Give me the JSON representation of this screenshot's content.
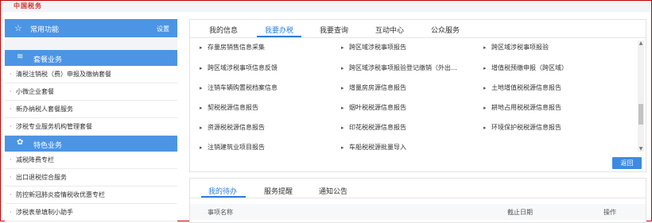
{
  "header": {
    "logo_text": "中国税务"
  },
  "sidebar": {
    "common": {
      "title": "常用功能",
      "setting": "设置"
    },
    "categories": [
      {
        "title": "套餐业务",
        "items": [
          "清税注销税（费）申报及缴纳套餐",
          "小微企业套餐",
          "新办纳税人套餐服务",
          "涉税专业服务机构管理套餐"
        ]
      },
      {
        "title": "特色业务",
        "items": [
          "减税降费专栏",
          "出口退税综合服务",
          "防控新冠肺炎疫情税收优惠专栏",
          "涉税表单填制小助手"
        ]
      }
    ]
  },
  "main": {
    "tabs": [
      "我的信息",
      "我要办税",
      "我要查询",
      "互动中心",
      "公众服务"
    ],
    "active_tab": "我要办税",
    "links": [
      [
        "存量房销售信息采集",
        "跨区域涉税事项报告",
        "跨区域涉税事项报验"
      ],
      [
        "跨区域涉税事项信息反馈",
        "跨区域涉税事项报验登记缴销（外出…",
        "增值税预缴申报（跨区域）"
      ],
      [
        "注销车辆购置税档案信息",
        "增量房房源信息报告",
        "土地增值税税源信息报告"
      ],
      [
        "契税税源信息报告",
        "烟叶税税源信息报告",
        "耕地占用税税源信息报告"
      ],
      [
        "资源税税源信息报告",
        "印花税税源信息报告",
        "环境保护税税源信息报告"
      ],
      [
        "注销建筑业项目报告",
        "车船税税源批量导入",
        ""
      ]
    ],
    "back_button": "返回"
  },
  "bottom": {
    "tabs": [
      "我的待办",
      "服务提醒",
      "通知公告"
    ],
    "active_tab": "我的待办",
    "columns": [
      "事项名称",
      "截止日期",
      "操作"
    ]
  },
  "colors": {
    "accent": "#2d7fd8",
    "sidebar_header": "#4c95e4",
    "frame": "#c00000"
  }
}
